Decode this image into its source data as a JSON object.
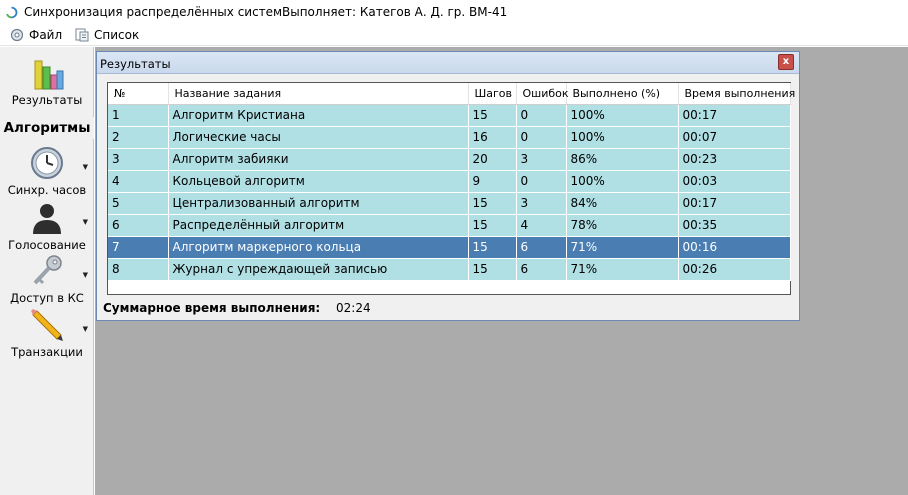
{
  "window": {
    "title": "Синхронизация распределённых систем.",
    "author": "Выполняет:  Категов А. Д.  гр. ВМ-41"
  },
  "menu": {
    "file": "Файл",
    "list": "Список"
  },
  "sidebar": {
    "results_label": "Результаты",
    "section_title": "Алгоритмы",
    "items": [
      {
        "label": "Синхр. часов",
        "icon": "clock-icon"
      },
      {
        "label": "Голосование",
        "icon": "person-icon"
      },
      {
        "label": "Доступ в КС",
        "icon": "key-icon"
      },
      {
        "label": "Транзакции",
        "icon": "pencil-icon"
      }
    ]
  },
  "results_window": {
    "title": "Результаты",
    "close_label": "x",
    "columns": [
      "№",
      "Название задания",
      "Шагов",
      "Ошибок",
      "Выполнено (%)",
      "Время выполнения"
    ],
    "rows": [
      [
        "1",
        "Алгоритм Кристиана",
        "15",
        "0",
        "100%",
        "00:17"
      ],
      [
        "2",
        "Логические часы",
        "16",
        "0",
        "100%",
        "00:07"
      ],
      [
        "3",
        "Алгоритм забияки",
        "20",
        "3",
        "86%",
        "00:23"
      ],
      [
        "4",
        "Кольцевой алгоритм",
        "9",
        "0",
        "100%",
        "00:03"
      ],
      [
        "5",
        "Централизованный алгоритм",
        "15",
        "3",
        "84%",
        "00:17"
      ],
      [
        "6",
        "Распределённый алгоритм",
        "15",
        "4",
        "78%",
        "00:35"
      ],
      [
        "7",
        "Алгоритм маркерного кольца",
        "15",
        "6",
        "71%",
        "00:16"
      ],
      [
        "8",
        "Журнал с упреждающей записью",
        "15",
        "6",
        "71%",
        "00:26"
      ]
    ],
    "selected_row": 7,
    "summary_label": "Суммарное время выполнения:",
    "summary_value": "02:24"
  },
  "colors": {
    "row_bg": "#b0dfe4",
    "selected_bg": "#4a7eb3",
    "workspace_bg": "#ababab"
  }
}
